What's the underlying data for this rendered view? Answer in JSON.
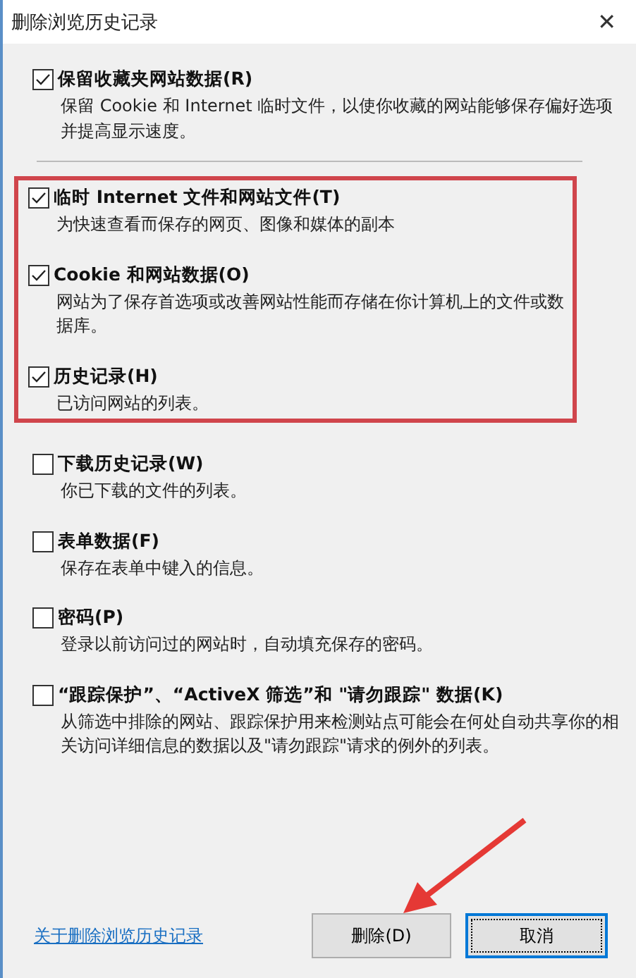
{
  "window": {
    "title": "删除浏览历史记录",
    "close": "✕"
  },
  "options": [
    {
      "label": "保留收藏夹网站数据(R)",
      "description": "保留 Cookie 和 Internet 临时文件，以使你收藏的网站能够保存偏好选项并提高显示速度。",
      "checked": true,
      "highlighted": false
    },
    {
      "label": "临时 Internet 文件和网站文件(T)",
      "description": "为快速查看而保存的网页、图像和媒体的副本",
      "checked": true,
      "highlighted": true
    },
    {
      "label": "Cookie 和网站数据(O)",
      "description": "网站为了保存首选项或改善网站性能而存储在你计算机上的文件或数据库。",
      "checked": true,
      "highlighted": true
    },
    {
      "label": "历史记录(H)",
      "description": "已访问网站的列表。",
      "checked": true,
      "highlighted": true
    },
    {
      "label": "下载历史记录(W)",
      "description": "你已下载的文件的列表。",
      "checked": false,
      "highlighted": false
    },
    {
      "label": "表单数据(F)",
      "description": "保存在表单中键入的信息。",
      "checked": false,
      "highlighted": false
    },
    {
      "label": "密码(P)",
      "description": "登录以前访问过的网站时，自动填充保存的密码。",
      "checked": false,
      "highlighted": false
    },
    {
      "label": "“跟踪保护”、“ActiveX 筛选”和 \"请勿跟踪\" 数据(K)",
      "description": "从筛选中排除的网站、跟踪保护用来检测站点可能会在何处自动共享你的相关访问详细信息的数据以及\"请勿跟踪\"请求的例外的列表。",
      "checked": false,
      "highlighted": false
    }
  ],
  "footer": {
    "link": "关于删除浏览历史记录",
    "buttons": [
      {
        "label": "删除(D)",
        "default": false
      },
      {
        "label": "取消",
        "default": true
      }
    ]
  }
}
